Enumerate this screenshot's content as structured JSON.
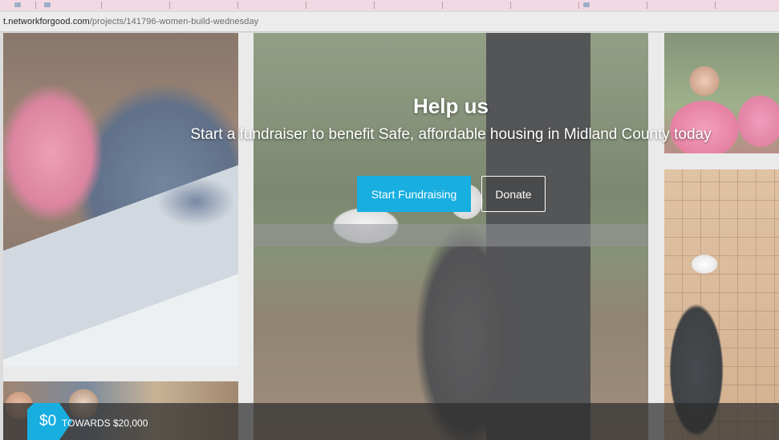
{
  "browser": {
    "url_prefix": "t.networkforgood.com",
    "url_path": "/projects/141796-women-build-wednesday"
  },
  "hero": {
    "title": "Help us",
    "subtitle": "Start a fundraiser to benefit Safe, affordable housing in Midland County today",
    "start_button": "Start Fundraising",
    "donate_button": "Donate"
  },
  "progress": {
    "raised": "$0",
    "towards_label": "TOWARDS $20,000"
  },
  "colors": {
    "accent": "#18aee0",
    "tab_strip": "#f3d9e3"
  }
}
